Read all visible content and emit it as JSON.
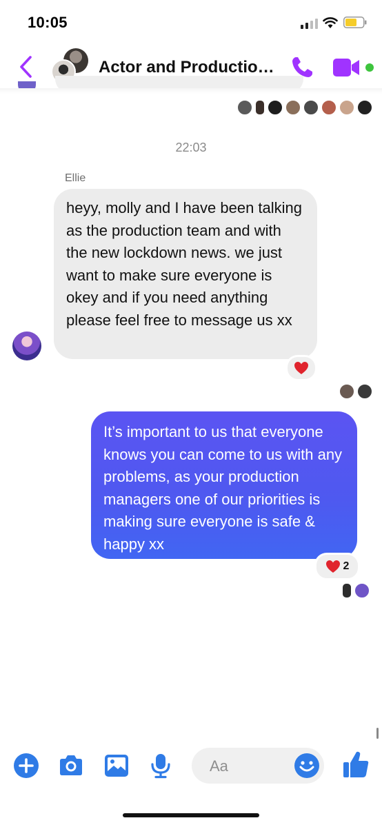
{
  "status_bar": {
    "time": "10:05"
  },
  "header": {
    "back_icon": "chevron-left-icon",
    "title": "Actor and Productio…",
    "call_icon": "phone-icon",
    "video_icon": "video-camera-icon",
    "accent_color": "#a033ff"
  },
  "conversation": {
    "timestamp": "22:03",
    "incoming": {
      "sender": "Ellie",
      "text": "heyy, molly and I have been talking as the production team and with the new lockdown news. we just want to make sure everyone is okey and if you need anything please feel free to message us xx",
      "reaction": "❤️"
    },
    "outgoing": {
      "text": "It’s important to us that everyone knows you can come to us with any problems, as your production managers one of our priorities is making sure everyone is safe & happy xx",
      "reaction": "❤️",
      "reaction_count": "2",
      "bubble_color": "#4e59f0"
    }
  },
  "composer": {
    "placeholder": "Aa",
    "tools": [
      "add-icon",
      "camera-icon",
      "gallery-icon",
      "microphone-icon"
    ],
    "emoji_icon": "emoji-icon",
    "like_icon": "thumbs-up-icon",
    "tool_color": "#2f7be6"
  }
}
